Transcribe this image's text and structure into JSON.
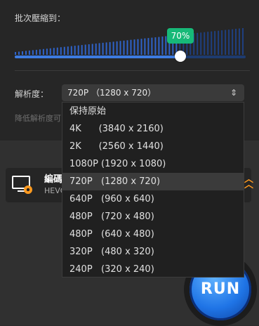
{
  "compression": {
    "label": "批次壓縮到：",
    "percent_label": "70%",
    "value": 0.7
  },
  "resolution": {
    "label": "解析度：",
    "selected": "720P  （1280 x 720）",
    "hint": "降低解析度可"
  },
  "encode": {
    "title": "編碼",
    "subtitle": "HEVC"
  },
  "dropdown": {
    "options": [
      "保持原始",
      "4K      (3840 x 2160)",
      "2K      (2560 x 1440)",
      "1080P (1920 x 1080)",
      "720P   (1280 x 720)",
      "640P   (960 x 640)",
      "480P   (720 x 480)",
      "480P   (640 x 480)",
      "320P   (480 x 320)",
      "240P   (320 x 240)"
    ],
    "selected_index": 4
  },
  "run_button": {
    "label": "RUN"
  },
  "colors": {
    "accent_blue": "#3d7be0",
    "tooltip_green": "#17b978",
    "chevron_orange": "#ff9a1f"
  }
}
